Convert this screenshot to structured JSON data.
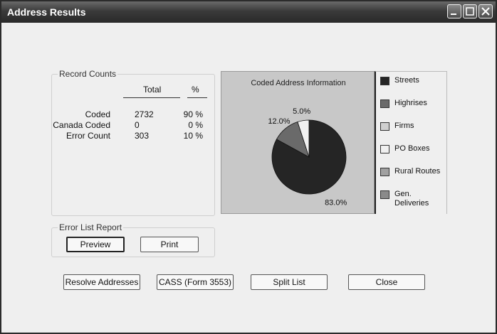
{
  "window": {
    "title": "Address Results"
  },
  "record_counts": {
    "legend": "Record Counts",
    "col_total": "Total",
    "col_percent": "%",
    "rows": [
      {
        "label": "Coded",
        "total": "2732",
        "percent": "90 %"
      },
      {
        "label": "Canada Coded",
        "total": "0",
        "percent": "0 %"
      },
      {
        "label": "Error Count",
        "total": "303",
        "percent": "10 %"
      }
    ]
  },
  "chart_data": {
    "type": "pie",
    "title": "Coded Address Information",
    "slices": [
      {
        "name": "Streets",
        "value": 83.0,
        "label": "83.0%",
        "color": "#252525"
      },
      {
        "name": "Highrises",
        "value": 12.0,
        "label": "12.0%",
        "color": "#6a6a6a"
      },
      {
        "name": "PO Boxes",
        "value": 5.0,
        "label": "5.0%",
        "color": "#f0f0f0"
      }
    ],
    "legend": [
      {
        "label": "Streets",
        "color": "#252525"
      },
      {
        "label": "Highrises",
        "color": "#6a6a6a"
      },
      {
        "label": "Firms",
        "color": "#cfcfcf"
      },
      {
        "label": "PO Boxes",
        "color": "#f0f0f0"
      },
      {
        "label": "Rural Routes",
        "color": "#a0a0a0"
      },
      {
        "label": "Gen. Deliveries",
        "color": "#8a8a8a"
      }
    ],
    "legend_placement": "right"
  },
  "error_list": {
    "legend": "Error List Report",
    "preview_label": "Preview",
    "print_label": "Print"
  },
  "actions": {
    "resolve_label": "Resolve Addresses",
    "cass_label": "CASS (Form 3553)",
    "split_label": "Split List",
    "close_label": "Close"
  }
}
